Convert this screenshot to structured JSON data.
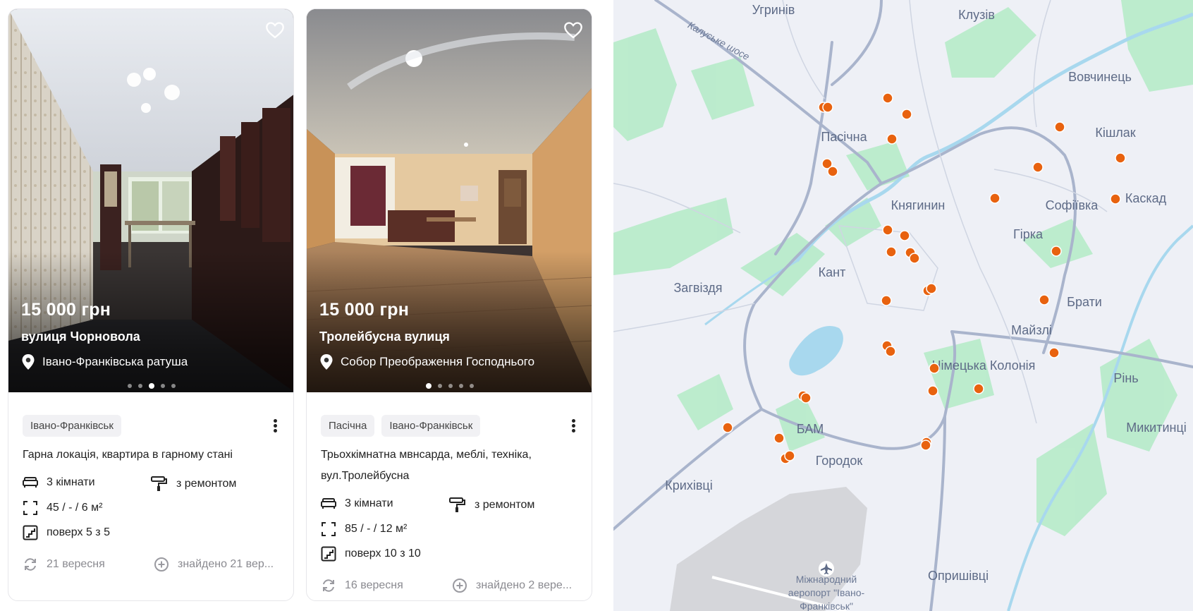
{
  "listings": [
    {
      "price": "15 000 грн",
      "street": "вулиця Чорновола",
      "landmark": "Івано-Франківська ратуша",
      "photo_count": 5,
      "active_photo": 3,
      "tags": [
        "Івано-Франківськ"
      ],
      "description": "Гарна локація, квартира в гарному стані",
      "rooms": "3 кімнати",
      "renovation": "з ремонтом",
      "area": "45 / - / 6 м²",
      "floor": "поверх 5 з 5",
      "updated": "21 вересня",
      "found": "знайдено 21 вер..."
    },
    {
      "price": "15 000 грн",
      "street": "Тролейбусна вулиця",
      "landmark": "Собор Преображення Господнього",
      "photo_count": 5,
      "active_photo": 1,
      "tags": [
        "Пасічна",
        "Івано-Франківськ"
      ],
      "description": "Трьохкімнатна мвнсарда, меблі, техніка, вул.Тролейбусна",
      "rooms": "3 кімнати",
      "renovation": "з ремонтом",
      "area": "85 / - / 12 м²",
      "floor": "поверх 10 з 10",
      "updated": "16 вересня",
      "found": "знайдено 2 вере..."
    }
  ],
  "map": {
    "labels": {
      "ugryniv": "Угринів",
      "kluziv": "Клузів",
      "kalush_road": "Калуське шосе",
      "vovchynets": "Вовчинець",
      "pasichna": "Пасічна",
      "kishlak": "Кішлак",
      "knyahynyn": "Княгинин",
      "sofiivka": "Софіївка",
      "kaskad": "Каскад",
      "hirka": "Гірка",
      "kant": "Кант",
      "zahvizdia": "Загвіздя",
      "braty": "Брати",
      "maizli": "Майзлі",
      "nimetska_koloniia": "Німецька Колонія",
      "rin": "Рінь",
      "mykytyntsi": "Микитинці",
      "bam": "БАМ",
      "horodok": "Городок",
      "kryhivtsi": "Крихівці",
      "opryshivtsi": "Опришівці",
      "airport_line1": "Міжнародний",
      "airport_line2": "аеропорт \"Івано-",
      "airport_line3": "Франківськ\""
    },
    "marker_color": "#e8620f",
    "road_color": "#a9b4cc",
    "green_color": "#b6ebc9",
    "water_color": "#a8d8ee"
  }
}
